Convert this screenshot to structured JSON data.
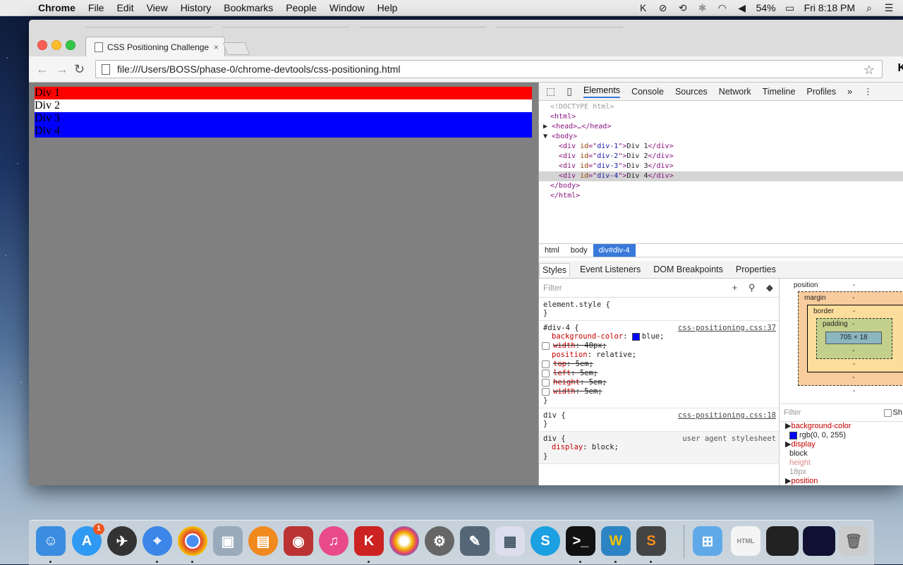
{
  "menubar": {
    "app": "Chrome",
    "items": [
      "File",
      "Edit",
      "View",
      "History",
      "Bookmarks",
      "People",
      "Window",
      "Help"
    ],
    "battery": "54%",
    "clock": "Fri 8:18 PM"
  },
  "browser": {
    "tab_title": "CSS Positioning Challenge",
    "tab_close": "×",
    "url": "file:///Users/BOSS/phase-0/chrome-devtools/css-positioning.html"
  },
  "page": {
    "divs": [
      {
        "label": "Div 1",
        "color": "#ff0000"
      },
      {
        "label": "Div 2",
        "color": "#ffffff"
      },
      {
        "label": "Div 3",
        "color": "#0000ff"
      },
      {
        "label": "Div 4",
        "color": "#0000ff"
      }
    ],
    "background": "#808080"
  },
  "devtools": {
    "tabs": [
      "Elements",
      "Console",
      "Sources",
      "Network",
      "Timeline",
      "Profiles"
    ],
    "more": "»",
    "dom": {
      "doctype": "<!DOCTYPE html>",
      "html_open": "<html>",
      "head": "<head>…</head>",
      "body_open": "<body>",
      "divs": [
        {
          "id": "div-1",
          "text": "Div 1"
        },
        {
          "id": "div-2",
          "text": "Div 2"
        },
        {
          "id": "div-3",
          "text": "Div 3"
        },
        {
          "id": "div-4",
          "text": "Div 4"
        }
      ],
      "body_close": "</body>",
      "html_close": "</html>"
    },
    "breadcrumbs": [
      "html",
      "body",
      "div#div-4"
    ],
    "subtabs": [
      "Styles",
      "Event Listeners",
      "DOM Breakpoints",
      "Properties"
    ],
    "filter_placeholder": "Filter",
    "styles": {
      "element_style": "element.style {",
      "rule1_selector": "#div-4 {",
      "rule1_source": "css-positioning.css:37",
      "rule1_props": [
        {
          "name": "background-color",
          "value": "blue;",
          "struck": false,
          "swatch": true
        },
        {
          "name": "width",
          "value": "40px;",
          "struck": true
        },
        {
          "name": "position",
          "value": "relative;",
          "struck": false
        },
        {
          "name": "top",
          "value": "5em;",
          "struck": true
        },
        {
          "name": "left",
          "value": "5em;",
          "struck": true
        },
        {
          "name": "height",
          "value": "5em;",
          "struck": true
        },
        {
          "name": "width",
          "value": "5em;",
          "struck": true
        }
      ],
      "rule2_selector": "div {",
      "rule2_source": "css-positioning.css:18",
      "rule3_selector": "div {",
      "rule3_source": "user agent stylesheet",
      "rule3_prop_name": "display",
      "rule3_prop_value": "block;",
      "close": "}"
    },
    "metrics": {
      "position": "position",
      "margin": "margin",
      "border": "border",
      "padding": "padding",
      "dash": "-",
      "content": "705 × 18"
    },
    "computed": {
      "filter": "Filter",
      "show_label": "Sh",
      "rows": [
        {
          "name": "background-color",
          "value": "rgb(0, 0, 255)"
        },
        {
          "name": "display",
          "value": "block"
        },
        {
          "name": "height",
          "value": "18px"
        },
        {
          "name": "position",
          "value": ""
        }
      ]
    }
  },
  "dock": {
    "appstore_badge": "1"
  }
}
